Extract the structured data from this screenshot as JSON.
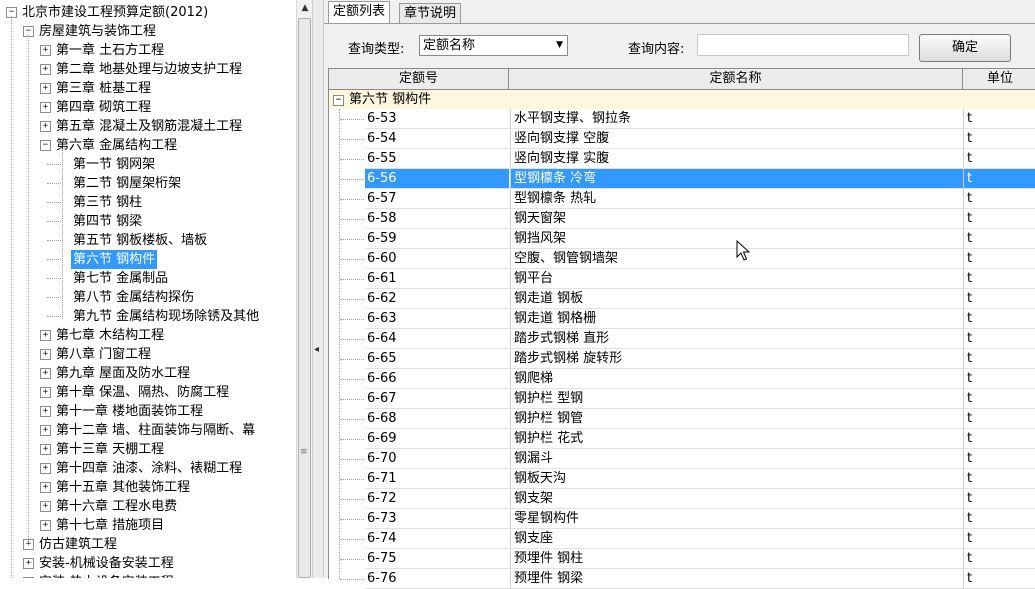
{
  "tree": {
    "items": [
      {
        "label": "北京市建设工程预算定额(2012)",
        "level": 0,
        "toggle": "−"
      },
      {
        "label": "房屋建筑与装饰工程",
        "level": 1,
        "toggle": "−"
      },
      {
        "label": "第一章  土石方工程",
        "level": 2,
        "toggle": "+"
      },
      {
        "label": "第二章  地基处理与边坡支护工程",
        "level": 2,
        "toggle": "+"
      },
      {
        "label": "第三章  桩基工程",
        "level": 2,
        "toggle": "+"
      },
      {
        "label": "第四章  砌筑工程",
        "level": 2,
        "toggle": "+"
      },
      {
        "label": "第五章  混凝土及钢筋混凝土工程",
        "level": 2,
        "toggle": "+"
      },
      {
        "label": "第六章  金属结构工程",
        "level": 2,
        "toggle": "−"
      },
      {
        "label": "第一节  钢网架",
        "level": 3,
        "toggle": ""
      },
      {
        "label": "第二节  钢屋架桁架",
        "level": 3,
        "toggle": ""
      },
      {
        "label": "第三节  钢柱",
        "level": 3,
        "toggle": ""
      },
      {
        "label": "第四节  钢梁",
        "level": 3,
        "toggle": ""
      },
      {
        "label": "第五节  钢板楼板、墙板",
        "level": 3,
        "toggle": ""
      },
      {
        "label": "第六节  钢构件",
        "level": 3,
        "toggle": "",
        "selected": true
      },
      {
        "label": "第七节  金属制品",
        "level": 3,
        "toggle": ""
      },
      {
        "label": "第八节  金属结构探伤",
        "level": 3,
        "toggle": ""
      },
      {
        "label": "第九节  金属结构现场除锈及其他",
        "level": 3,
        "toggle": ""
      },
      {
        "label": "第七章  木结构工程",
        "level": 2,
        "toggle": "+"
      },
      {
        "label": "第八章  门窗工程",
        "level": 2,
        "toggle": "+"
      },
      {
        "label": "第九章  屋面及防水工程",
        "level": 2,
        "toggle": "+"
      },
      {
        "label": "第十章  保温、隔热、防腐工程",
        "level": 2,
        "toggle": "+"
      },
      {
        "label": "第十一章  楼地面装饰工程",
        "level": 2,
        "toggle": "+"
      },
      {
        "label": "第十二章  墙、柱面装饰与隔断、幕",
        "level": 2,
        "toggle": "+"
      },
      {
        "label": "第十三章  天棚工程",
        "level": 2,
        "toggle": "+"
      },
      {
        "label": "第十四章  油漆、涂料、裱糊工程",
        "level": 2,
        "toggle": "+"
      },
      {
        "label": "第十五章  其他装饰工程",
        "level": 2,
        "toggle": "+"
      },
      {
        "label": "第十六章  工程水电费",
        "level": 2,
        "toggle": "+"
      },
      {
        "label": "第十七章  措施项目",
        "level": 2,
        "toggle": "+"
      },
      {
        "label": "仿古建筑工程",
        "level": 1,
        "toggle": "+"
      },
      {
        "label": "安装-机械设备安装工程",
        "level": 1,
        "toggle": "+"
      },
      {
        "label": "安装-热力设备安装工程",
        "level": 1,
        "toggle": "+"
      }
    ]
  },
  "tabs": [
    {
      "label": "定额列表",
      "active": true
    },
    {
      "label": "章节说明",
      "active": false
    }
  ],
  "query": {
    "type_label": "查询类型:",
    "type_value": "定额名称",
    "content_label": "查询内容:",
    "content_value": "",
    "confirm_label": "确定"
  },
  "grid": {
    "headers": {
      "code": "定额号",
      "name": "定额名称",
      "unit": "单位"
    },
    "group_label": "第六节  钢构件",
    "rows": [
      {
        "code": "6-53",
        "name": "水平钢支撑、钢拉条",
        "unit": "t"
      },
      {
        "code": "6-54",
        "name": "竖向钢支撑  空腹",
        "unit": "t"
      },
      {
        "code": "6-55",
        "name": "竖向钢支撑  实腹",
        "unit": "t"
      },
      {
        "code": "6-56",
        "name": "型钢檩条  冷弯",
        "unit": "t",
        "selected": true
      },
      {
        "code": "6-57",
        "name": "型钢檩条  热轧",
        "unit": "t"
      },
      {
        "code": "6-58",
        "name": "钢天窗架",
        "unit": "t"
      },
      {
        "code": "6-59",
        "name": "钢挡风架",
        "unit": "t"
      },
      {
        "code": "6-60",
        "name": "空腹、钢管钢墙架",
        "unit": "t"
      },
      {
        "code": "6-61",
        "name": "钢平台",
        "unit": "t"
      },
      {
        "code": "6-62",
        "name": "钢走道  钢板",
        "unit": "t"
      },
      {
        "code": "6-63",
        "name": "钢走道  钢格栅",
        "unit": "t"
      },
      {
        "code": "6-64",
        "name": "踏步式钢梯  直形",
        "unit": "t"
      },
      {
        "code": "6-65",
        "name": "踏步式钢梯  旋转形",
        "unit": "t"
      },
      {
        "code": "6-66",
        "name": "钢爬梯",
        "unit": "t"
      },
      {
        "code": "6-67",
        "name": "钢护栏  型钢",
        "unit": "t"
      },
      {
        "code": "6-68",
        "name": "钢护栏  钢管",
        "unit": "t"
      },
      {
        "code": "6-69",
        "name": "钢护栏  花式",
        "unit": "t"
      },
      {
        "code": "6-70",
        "name": "钢漏斗",
        "unit": "t"
      },
      {
        "code": "6-71",
        "name": "钢板天沟",
        "unit": "t"
      },
      {
        "code": "6-72",
        "name": "钢支架",
        "unit": "t"
      },
      {
        "code": "6-73",
        "name": "零星钢构件",
        "unit": "t"
      },
      {
        "code": "6-74",
        "name": "钢支座",
        "unit": "t"
      },
      {
        "code": "6-75",
        "name": "预埋件  钢柱",
        "unit": "t"
      },
      {
        "code": "6-76",
        "name": "预埋件  钢梁",
        "unit": "t"
      }
    ]
  },
  "colors": {
    "selection": "#3399ff",
    "group_row": "#fdf7de"
  }
}
